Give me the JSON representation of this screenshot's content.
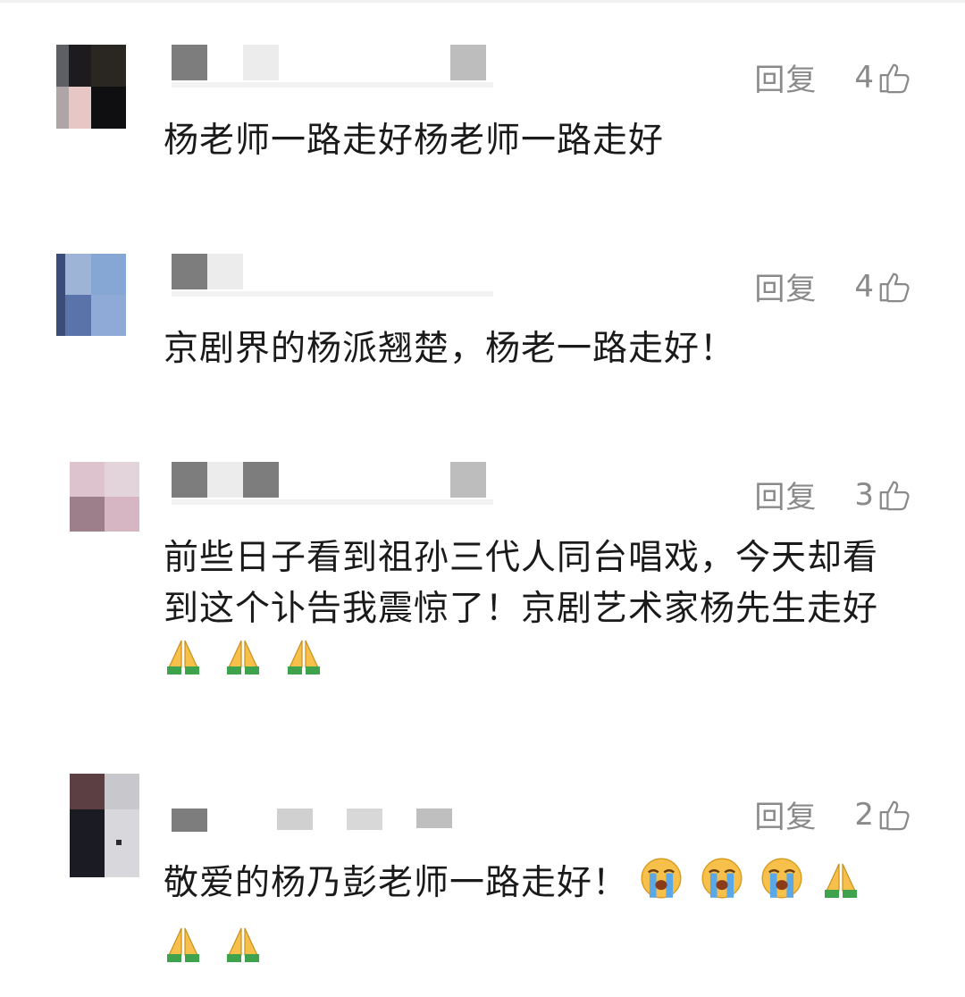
{
  "comments": [
    {
      "reply_label": "回复",
      "likes": "4",
      "text": "杨老师一路走好杨老师一路走好",
      "emojis_after": []
    },
    {
      "reply_label": "回复",
      "likes": "4",
      "text": "京剧界的杨派翘楚，杨老一路走好！",
      "emojis_after": []
    },
    {
      "reply_label": "回复",
      "likes": "3",
      "text": "前些日子看到祖孙三代人同台唱戏，今天却看到这个讣告我震惊了！京剧艺术家杨先生走好",
      "emojis_after": [
        "folded-hands",
        "folded-hands",
        "folded-hands"
      ]
    },
    {
      "reply_label": "回复",
      "likes": "2",
      "text": "敬爱的杨乃彭老师一路走好！",
      "emojis_after": [
        "loudly-crying-face",
        "loudly-crying-face",
        "loudly-crying-face",
        "folded-hands",
        "folded-hands",
        "folded-hands"
      ]
    }
  ],
  "colors": {
    "action_gray": "#8a8a8a",
    "text": "#1a1a1a",
    "emoji_skin": "#f6c04a",
    "emoji_sleeve": "#3fa34d",
    "tear_blue": "#5aa8e8"
  }
}
